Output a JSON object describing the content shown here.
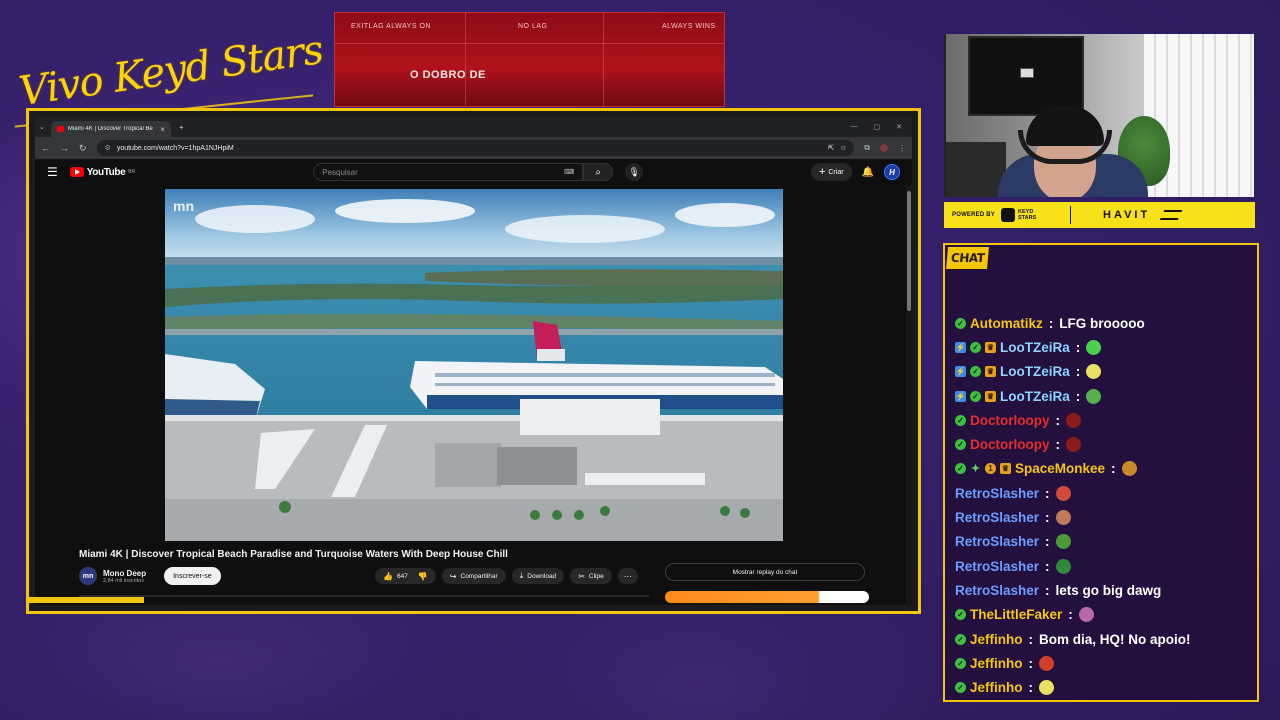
{
  "overlay": {
    "script_title": "Vivo Keyd Stars",
    "banner": {
      "small": [
        "EXITLAG ALWAYS ON",
        "NO LAG",
        "ALWAYS WINS"
      ],
      "main": "O DOBRO DE"
    }
  },
  "browser": {
    "tab_title": "Miami 4K | Discover Tropical Be",
    "tab_close": "×",
    "new_tab": "+",
    "window_controls": [
      "—",
      "▢",
      "✕"
    ],
    "nav": [
      "←",
      "→",
      "↻"
    ],
    "url": "youtube.com/watch?v=1hpA1NJHpiM",
    "addr_icons": [
      "⇱",
      "☆",
      "⧉"
    ]
  },
  "youtube": {
    "logo": "YouTube",
    "region": "BR",
    "search_placeholder": "Pesquisar",
    "create_label": "Criar",
    "video_title": "Miami 4K | Discover Tropical Beach Paradise and Turquoise Waters With Deep House Chill",
    "channel": {
      "name": "Mono Deep",
      "subs": "2,84 mil inscritos",
      "avatar": "mn",
      "subscribe_label": "Inscrever-se"
    },
    "actions": {
      "likes": "647",
      "share": "Compartilhar",
      "download": "Download",
      "clip": "Clipe"
    },
    "chat_replay": "Mostrar replay do chat",
    "watermark": "mn"
  },
  "sponsor": {
    "powered_by": "POWERED BY",
    "keyd_logo": "KEYD STARS",
    "havit": "HAVIT"
  },
  "chat": {
    "header": "CHAT",
    "messages": [
      {
        "badges": [
          "check"
        ],
        "user": "Automatikz",
        "color": "#f5c518",
        "text": "LFG brooooo",
        "emote": ""
      },
      {
        "badges": [
          "prime",
          "check",
          "crown"
        ],
        "user": "LooTZeiRa",
        "color": "#8fd3ff",
        "text": "",
        "emote": "#4ccf4c"
      },
      {
        "badges": [
          "prime",
          "check",
          "crown"
        ],
        "user": "LooTZeiRa",
        "color": "#8fd3ff",
        "text": "",
        "emote": "#e8e060"
      },
      {
        "badges": [
          "prime",
          "check",
          "crown"
        ],
        "user": "LooTZeiRa",
        "color": "#8fd3ff",
        "text": "",
        "emote": "#58b04a"
      },
      {
        "badges": [
          "check"
        ],
        "user": "Doctorloopy",
        "color": "#e3302a",
        "text": "",
        "emote": "#8a1a1a"
      },
      {
        "badges": [
          "check"
        ],
        "user": "Doctorloopy",
        "color": "#e3302a",
        "text": "",
        "emote": "#8a1a1a"
      },
      {
        "badges": [
          "check",
          "diamond",
          "num",
          "crown"
        ],
        "user": "SpaceMonkee",
        "color": "#f5c518",
        "text": "",
        "emote": "#c98a2a"
      },
      {
        "badges": [],
        "user": "RetroSlasher",
        "color": "#6d9cff",
        "text": "",
        "emote": "#d14a3a"
      },
      {
        "badges": [],
        "user": "RetroSlasher",
        "color": "#6d9cff",
        "text": "",
        "emote": "#c07a5a"
      },
      {
        "badges": [],
        "user": "RetroSlasher",
        "color": "#6d9cff",
        "text": "",
        "emote": "#4a9a3a"
      },
      {
        "badges": [],
        "user": "RetroSlasher",
        "color": "#6d9cff",
        "text": "",
        "emote": "#2f8a3a"
      },
      {
        "badges": [],
        "user": "RetroSlasher",
        "color": "#6d9cff",
        "text": "lets go big dawg",
        "emote": ""
      },
      {
        "badges": [
          "check"
        ],
        "user": "TheLittleFaker",
        "color": "#f5c518",
        "text": "",
        "emote": "#b86aa8"
      },
      {
        "badges": [
          "check"
        ],
        "user": "Jeffinho",
        "color": "#f5c518",
        "text": "Bom dia, HQ! No apoio!",
        "emote": ""
      },
      {
        "badges": [
          "check"
        ],
        "user": "Jeffinho",
        "color": "#f5c518",
        "text": "",
        "emote": "#d0402a"
      },
      {
        "badges": [
          "check"
        ],
        "user": "Jeffinho",
        "color": "#f5c518",
        "text": "",
        "emote": "#e8e060"
      }
    ]
  },
  "colors": {
    "accent_yellow": "#f3c60a",
    "bg_purple": "#34206a",
    "banner_red": "#b0121b"
  }
}
